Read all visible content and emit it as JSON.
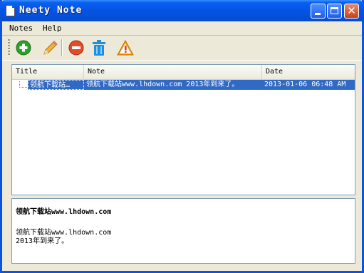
{
  "window": {
    "title": "Neety Note"
  },
  "menubar": {
    "items": [
      "Notes",
      "Help"
    ]
  },
  "toolbar": {
    "buttons": [
      {
        "icon": "add-icon"
      },
      {
        "icon": "pencil-icon"
      },
      {
        "icon": "minus-icon"
      },
      {
        "icon": "trash-icon"
      },
      {
        "icon": "warning-icon"
      }
    ]
  },
  "notes_list": {
    "columns": [
      "Title",
      "Note",
      "Date"
    ],
    "rows": [
      {
        "title": "领航下载站…",
        "note": "领航下载站www.lhdown.com 2013年到来了。",
        "date": "2013-01-06 06:48 AM",
        "selected": true
      }
    ]
  },
  "detail": {
    "title": "领航下载站www.lhdown.com",
    "lines": [
      "领航下载站www.lhdown.com",
      "2013年到来了。"
    ]
  },
  "colors": {
    "title_bar": "#0553e4",
    "selection": "#316ac5",
    "face": "#ece9d8"
  }
}
